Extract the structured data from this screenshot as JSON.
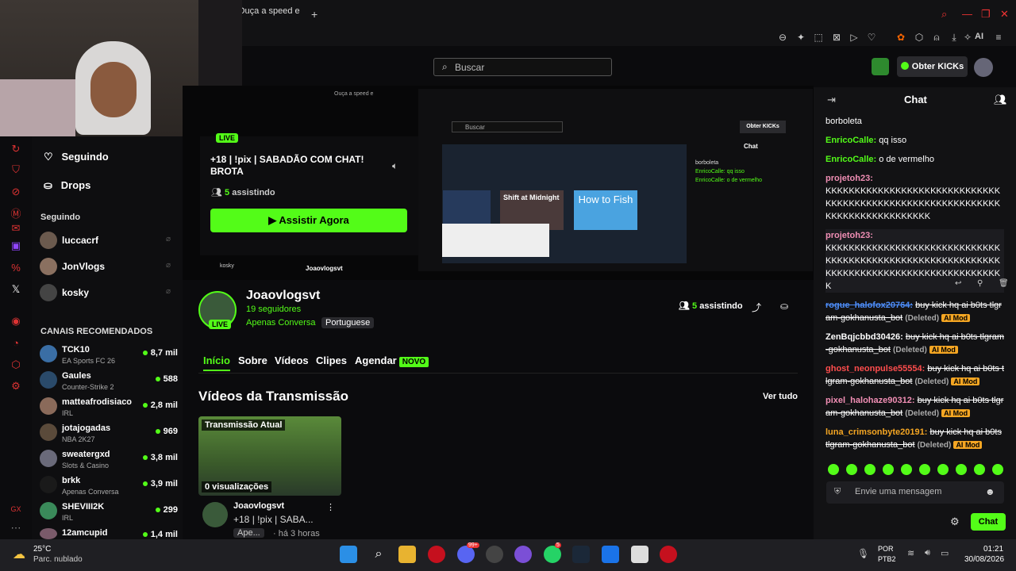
{
  "browser": {
    "tab_title": "Ouça a speed e",
    "new_tab": "+",
    "ai_label": "AI"
  },
  "header": {
    "search_placeholder": "Buscar",
    "kicks_label": "Obter KICKs"
  },
  "sidebar": {
    "nav": [
      {
        "label": "Seguindo",
        "icon": "heart-icon"
      },
      {
        "label": "Drops",
        "icon": "gift-icon"
      }
    ],
    "following_title": "Seguindo",
    "following": [
      {
        "name": "luccacrf"
      },
      {
        "name": "JonVlogs"
      },
      {
        "name": "kosky"
      }
    ],
    "recommended_title": "CANAIS RECOMENDADOS",
    "recommended": [
      {
        "name": "TCK10",
        "category": "EA Sports FC 26",
        "viewers": "8,7 mil"
      },
      {
        "name": "Gaules",
        "category": "Counter-Strike 2",
        "viewers": "588"
      },
      {
        "name": "matteafrodisiaco",
        "category": "IRL",
        "viewers": "2,8 mil"
      },
      {
        "name": "jotajogadas",
        "category": "NBA 2K27",
        "viewers": "969"
      },
      {
        "name": "sweatergxd",
        "category": "Slots & Casino",
        "viewers": "3,8 mil"
      },
      {
        "name": "brkk",
        "category": "Apenas Conversa",
        "viewers": "3,9 mil"
      },
      {
        "name": "SHEVIII2K",
        "category": "IRL",
        "viewers": "299"
      },
      {
        "name": "12amcupid",
        "category": "",
        "viewers": "1,4 mil"
      }
    ]
  },
  "live_card": {
    "badge": "LIVE",
    "title": "+18 | !pix | SABADÃO COM CHAT! BROTA",
    "watching_count": "5",
    "watching_label": "assistindo",
    "cta": "Assistir Agora"
  },
  "inner": {
    "tab_title": "Ouça a speed e",
    "search_placeholder": "Buscar",
    "kicks_label": "Obter KICKs",
    "chat_title": "Chat",
    "game1": "Shift at Midnight",
    "game2": "How to Fish",
    "lines": [
      "borboleta",
      "EnricoCalle: qq isso",
      "EnricoCalle: o de vermelho"
    ],
    "streamer": "Joaovlogsvt",
    "user_left": "kosky"
  },
  "channel": {
    "name": "Joaovlogsvt",
    "followers": "19 seguidores",
    "category": "Apenas Conversa",
    "language": "Portuguese",
    "badge": "LIVE",
    "watching_count": "5",
    "watching_label": "assistindo",
    "tabs": [
      "Início",
      "Sobre",
      "Vídeos",
      "Clipes",
      "Agendar"
    ],
    "new_badge": "NOVO",
    "section_title": "Vídeos da Transmissão",
    "see_all": "Ver tudo",
    "video": {
      "label": "Transmissão Atual",
      "views": "0 visualizações",
      "channel": "Joaovlogsvt",
      "title": "+18 | !pix | SABA...",
      "tag": "Ape...",
      "age": "· há 3 horas"
    }
  },
  "chat": {
    "title": "Chat",
    "messages": [
      {
        "user": "",
        "text": "borboleta",
        "color": "#ffffff"
      },
      {
        "user": "EnricoCalle:",
        "text": " qq isso",
        "color": "#53fc18"
      },
      {
        "user": "EnricoCalle:",
        "text": " o de vermelho",
        "color": "#53fc18"
      },
      {
        "user": "projetoh23:",
        "text": "KKKKKKKKKKKKKKKKKKKKKKKKKKKKKKKKKKKKKKKKKKKKKKKKKKKKKKKKKKKKKKKKKKKKKKKKKKKKKK",
        "color": "#f08eb4"
      },
      {
        "user": "projetoh23:",
        "text": "KKKKKKKKKKKKKKKKKKKKKKKKKKKKKKKKKKKKKKKKKKKKKKKKKKKKKKKKKKKKKKKKKKKKKKKKKKKKKKKKKKKKKKKKKKK",
        "color": "#f08eb4"
      }
    ],
    "deleted": [
      {
        "user": "rogue_halofox20764:",
        "text": "buy kick hq ai b0ts tlgram-gokhanusta_bot",
        "color": "#4c8bf5"
      },
      {
        "user": "ZenBqjcbbd30426:",
        "text": "buy kick hq ai b0ts tlgram-gokhanusta_bot",
        "color": "#ffffff"
      },
      {
        "user": "ghost_neonpulse55554:",
        "text": "buy kick hq ai b0ts tlgram-gokhanusta_bot",
        "color": "#ff4d4d"
      },
      {
        "user": "pixel_halohaze90312:",
        "text": "buy kick hq ai b0ts tlgram-gokhanusta_bot",
        "color": "#f08eb4"
      },
      {
        "user": "luna_crimsonbyte20191:",
        "text": "buy kick hq ai b0ts tlgram-gokhanusta_bot",
        "color": "#f5a623"
      }
    ],
    "deleted_label": "(Deleted)",
    "aimod_label": "AI Mod",
    "input_placeholder": "Envie uma mensagem",
    "send_label": "Chat"
  },
  "taskbar": {
    "weather_temp": "25°C",
    "weather_desc": "Parc. nublado",
    "lang1": "POR",
    "lang2": "PTB2",
    "time": "01:21",
    "date": "30/08/2026",
    "badge1": "99+",
    "badge2": "5"
  }
}
